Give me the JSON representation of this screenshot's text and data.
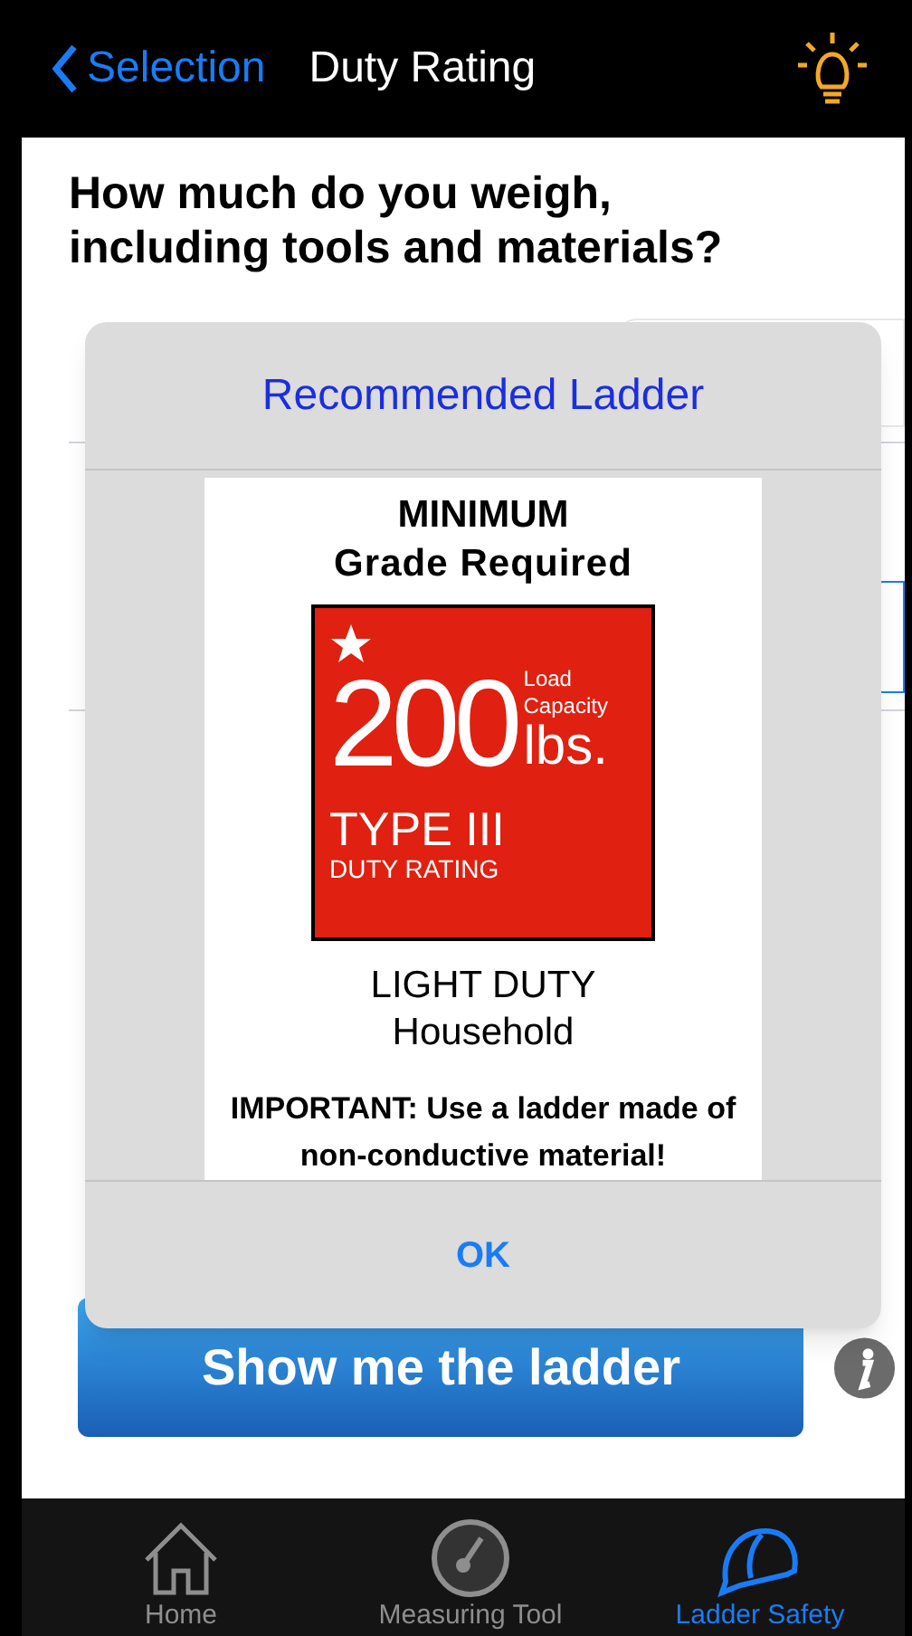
{
  "nav": {
    "back": "Selection",
    "title": "Duty Rating"
  },
  "question": "How much do you weigh, including tools and materials?",
  "dialog": {
    "title": "Recommended Ladder",
    "heading": "MINIMUM",
    "subheading": "Grade Required",
    "badge": {
      "number": "200",
      "label_top": "Load",
      "label_bottom": "Capacity",
      "unit": "lbs.",
      "type": "TYPE III",
      "rating": "DUTY RATING"
    },
    "duty": "LIGHT DUTY",
    "use": "Household",
    "note": "IMPORTANT: Use a ladder made of non-conductive material!",
    "button": "OK"
  },
  "action_button": "Show me the ladder",
  "tabs": [
    {
      "kind": "home",
      "label": "Home",
      "selected": false
    },
    {
      "kind": "gauge",
      "label": "Measuring Tool",
      "selected": false
    },
    {
      "kind": "helmet",
      "label": "Ladder Safety",
      "selected": true
    }
  ]
}
